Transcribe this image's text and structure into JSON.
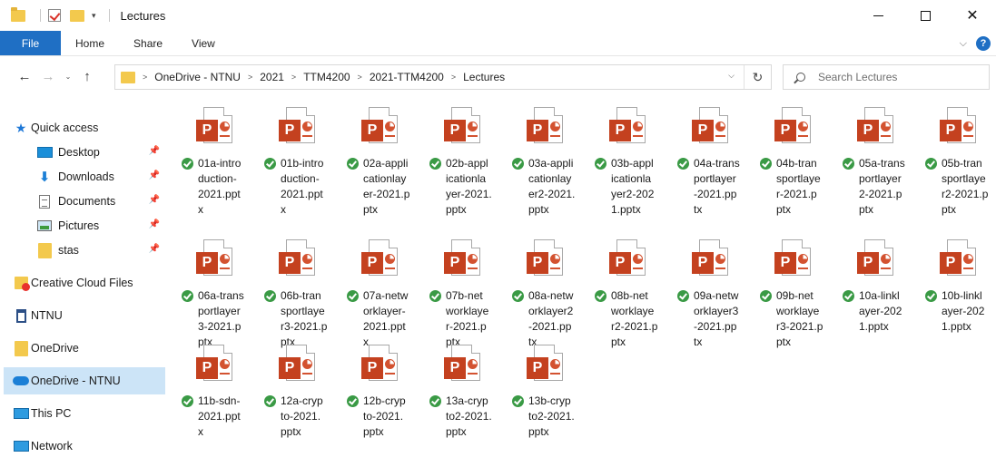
{
  "window": {
    "title": "Lectures"
  },
  "ribbon": {
    "tabs": [
      "File",
      "Home",
      "Share",
      "View"
    ]
  },
  "address": {
    "crumbs": [
      "OneDrive - NTNU",
      "2021",
      "TTM4200",
      "2021-TTM4200",
      "Lectures"
    ]
  },
  "search": {
    "placeholder": "Search Lectures"
  },
  "sidebar": {
    "items": [
      {
        "label": "Quick access"
      },
      {
        "label": "Desktop"
      },
      {
        "label": "Downloads"
      },
      {
        "label": "Documents"
      },
      {
        "label": "Pictures"
      },
      {
        "label": "stas"
      },
      {
        "label": "Creative Cloud Files"
      },
      {
        "label": "NTNU"
      },
      {
        "label": "OneDrive"
      },
      {
        "label": "OneDrive - NTNU"
      },
      {
        "label": "This PC"
      },
      {
        "label": "Network"
      }
    ]
  },
  "files": [
    {
      "label": "01a-intro\nduction-\n2021.ppt\nx"
    },
    {
      "label": "01b-intro\nduction-\n2021.ppt\nx"
    },
    {
      "label": "02a-appli\ncationlay\ner-2021.p\nptx"
    },
    {
      "label": "02b-appl\nicationla\nyer-2021.\npptx"
    },
    {
      "label": "03a-appli\ncationlay\ner2-2021.\npptx"
    },
    {
      "label": "03b-appl\nicationla\nyer2-202\n1.pptx"
    },
    {
      "label": "04a-trans\nportlayer\n-2021.pp\ntx"
    },
    {
      "label": "04b-tran\nsportlaye\nr-2021.p\nptx"
    },
    {
      "label": "05a-trans\nportlayer\n2-2021.p\nptx"
    },
    {
      "label": "05b-tran\nsportlaye\nr2-2021.p\nptx"
    },
    {
      "label": "06a-trans\nportlayer\n3-2021.p\nptx"
    },
    {
      "label": "06b-tran\nsportlaye\nr3-2021.p\nptx"
    },
    {
      "label": "07a-netw\norklayer-\n2021.ppt\nx"
    },
    {
      "label": "07b-net\nworklaye\nr-2021.p\nptx"
    },
    {
      "label": "08a-netw\norklayer2\n-2021.pp\ntx"
    },
    {
      "label": "08b-net\nworklaye\nr2-2021.p\nptx"
    },
    {
      "label": "09a-netw\norklayer3\n-2021.pp\ntx"
    },
    {
      "label": "09b-net\nworklaye\nr3-2021.p\nptx"
    },
    {
      "label": "10a-linkl\nayer-202\n1.pptx"
    },
    {
      "label": "10b-linkl\nayer-202\n1.pptx"
    },
    {
      "label": "11b-sdn-\n2021.ppt\nx"
    },
    {
      "label": "12a-cryp\nto-2021.\npptx"
    },
    {
      "label": "12b-cryp\nto-2021.\npptx"
    },
    {
      "label": "13a-cryp\nto2-2021.\npptx"
    },
    {
      "label": "13b-cryp\nto2-2021.\npptx"
    }
  ],
  "colors": {
    "file_tab": "#1f6fc4",
    "selected": "#cce4f7",
    "powerpoint": "#c4411f",
    "sync_ok": "#3a9a45"
  },
  "icons": {
    "file": "powerpoint-file-icon",
    "status": "sync-ok-icon"
  }
}
